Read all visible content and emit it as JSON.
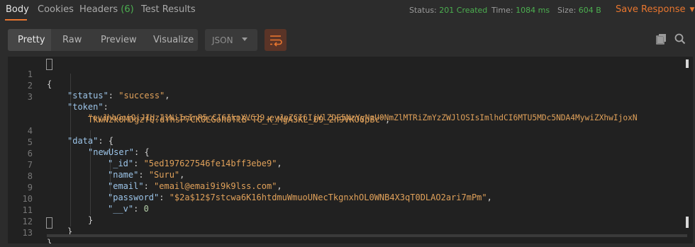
{
  "tabs": {
    "body": "Body",
    "cookies": "Cookies",
    "headers": "Headers",
    "headers_count": "(6)",
    "test_results": "Test Results"
  },
  "meta": {
    "status_label": "Status:",
    "status_value": "201 Created",
    "time_label": "Time:",
    "time_value": "1084 ms",
    "size_label": "Size:",
    "size_value": "604 B"
  },
  "save_response": "Save Response",
  "view_tabs": {
    "pretty": "Pretty",
    "raw": "Raw",
    "preview": "Preview",
    "visualize": "Visualize"
  },
  "format": {
    "selected": "JSON"
  },
  "icons": {
    "wrap": "wrap-lines-icon",
    "copy": "copy-icon",
    "search": "search-icon"
  },
  "colors": {
    "accent": "#e8762f",
    "success": "#4caf50",
    "json_key": "#9cc4e8",
    "json_string": "#e0a15a"
  },
  "code": {
    "line_numbers": [
      "1",
      "2",
      "3",
      "",
      "4",
      "5",
      "6",
      "7",
      "8",
      "9",
      "10",
      "11",
      "12",
      "13"
    ],
    "open_brace": "{",
    "close_brace": "}",
    "status_key": "\"status\"",
    "status_val": "\"success\"",
    "token_key": "\"token\"",
    "token_val_part1": "\"eyJhbGciOiJIUzI1NiIsInR5cCI6IkpXVCJ9.eyJpZCI6IjVlZDE5NzYyNzU0NmZlMTRiZmYzZWJlOSIsImlhdCI6MTU5MDc5NDA4MywiZXhwIjoxN",
    "token_val_part2": "TkwNzk0MDgzfQ.dYhsP7CK0LGohOTlB-TG_K_MgA3KL_09_2n9VKO6pBc\"",
    "data_key": "\"data\"",
    "newuser_key": "\"newUser\"",
    "id_key": "\"_id\"",
    "id_val": "\"5ed197627546fe14bff3ebe9\"",
    "name_key": "\"name\"",
    "name_val": "\"Suru\"",
    "email_key": "\"email\"",
    "email_val": "\"email@emai9i9k9lss.com\"",
    "password_key": "\"password\"",
    "password_val": "\"$2a$12$7stcwa6K16htdmuWmuoUNecTkgnxhOL0WNB4X3qT0DLAO2ari7mPm\"",
    "v_key": "\"__v\"",
    "v_val": "0"
  }
}
